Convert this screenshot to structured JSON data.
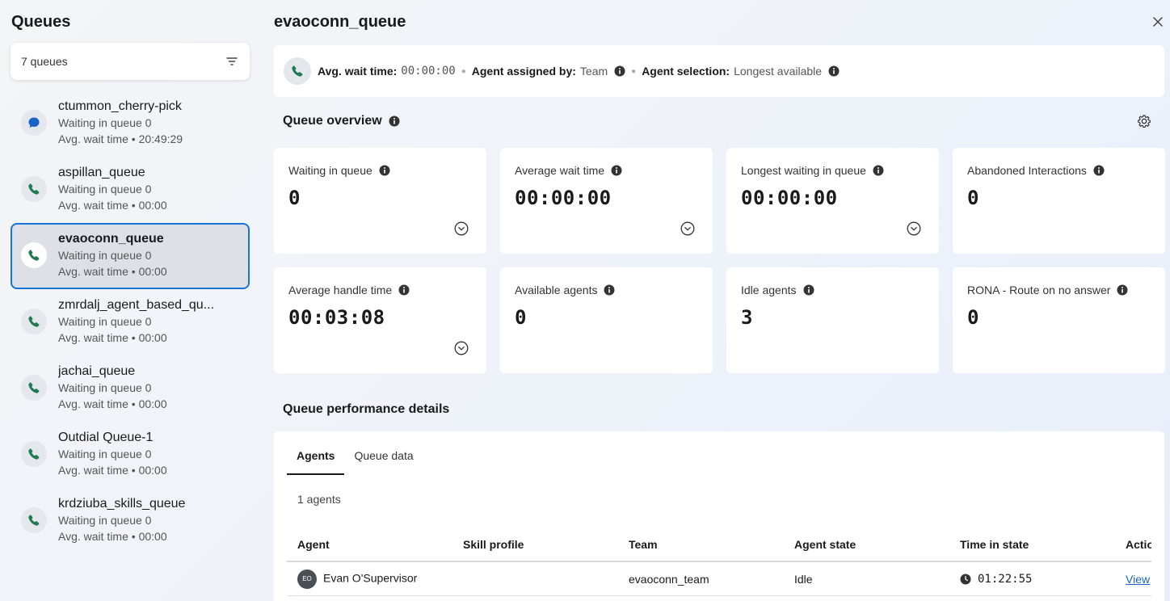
{
  "sidebar": {
    "title": "Queues",
    "queue_count": "7 queues",
    "items": [
      {
        "name": "ctummon_cherry-pick",
        "waiting": "Waiting in queue 0",
        "avg": "Avg. wait time • 20:49:29",
        "icon": "chat-icon"
      },
      {
        "name": "aspillan_queue",
        "waiting": "Waiting in queue 0",
        "avg": "Avg. wait time • 00:00",
        "icon": "phone-icon"
      },
      {
        "name": "evaoconn_queue",
        "waiting": "Waiting in queue 0",
        "avg": "Avg. wait time • 00:00",
        "icon": "phone-icon",
        "selected": true
      },
      {
        "name": "zmrdalj_agent_based_qu...",
        "waiting": "Waiting in queue 0",
        "avg": "Avg. wait time • 00:00",
        "icon": "phone-icon"
      },
      {
        "name": "jachai_queue",
        "waiting": "Waiting in queue 0",
        "avg": "Avg. wait time • 00:00",
        "icon": "phone-icon"
      },
      {
        "name": "Outdial Queue-1",
        "waiting": "Waiting in queue 0",
        "avg": "Avg. wait time • 00:00",
        "icon": "phone-icon"
      },
      {
        "name": "krdziuba_skills_queue",
        "waiting": "Waiting in queue 0",
        "avg": "Avg. wait time • 00:00",
        "icon": "phone-icon"
      }
    ]
  },
  "header": {
    "title": "evaoconn_queue"
  },
  "info_bar": {
    "avg_wait_label": "Avg. wait time:",
    "avg_wait_value": "00:00:00",
    "assigned_label": "Agent assigned by:",
    "assigned_value": "Team",
    "selection_label": "Agent selection:",
    "selection_value": "Longest available"
  },
  "overview": {
    "title": "Queue overview",
    "metrics": [
      {
        "label": "Waiting in queue",
        "value": "0",
        "expand": true
      },
      {
        "label": "Average wait time",
        "value": "00:00:00",
        "expand": true
      },
      {
        "label": "Longest waiting in queue",
        "value": "00:00:00",
        "expand": true
      },
      {
        "label": "Abandoned Interactions",
        "value": "0",
        "expand": false
      },
      {
        "label": "Average handle time",
        "value": "00:03:08",
        "expand": true
      },
      {
        "label": "Available agents",
        "value": "0",
        "expand": false
      },
      {
        "label": "Idle agents",
        "value": "3",
        "expand": false
      },
      {
        "label": "RONA - Route on no answer",
        "value": "0",
        "expand": false
      }
    ]
  },
  "performance": {
    "title": "Queue performance details",
    "tabs": [
      {
        "label": "Agents",
        "active": true
      },
      {
        "label": "Queue data",
        "active": false
      }
    ],
    "agents_count": "1 agents",
    "columns": [
      "Agent",
      "Skill profile",
      "Team",
      "Agent state",
      "Time in state",
      "Actio"
    ],
    "rows": [
      {
        "initials": "EO",
        "agent": "Evan O'Supervisor",
        "skill": "",
        "team": "evaoconn_team",
        "state": "Idle",
        "time": "01:22:55",
        "action": "View"
      }
    ]
  },
  "colors": {
    "accent_blue": "#1a73d6",
    "phone_green": "#1f7a52",
    "chat_blue": "#1a63c6"
  }
}
